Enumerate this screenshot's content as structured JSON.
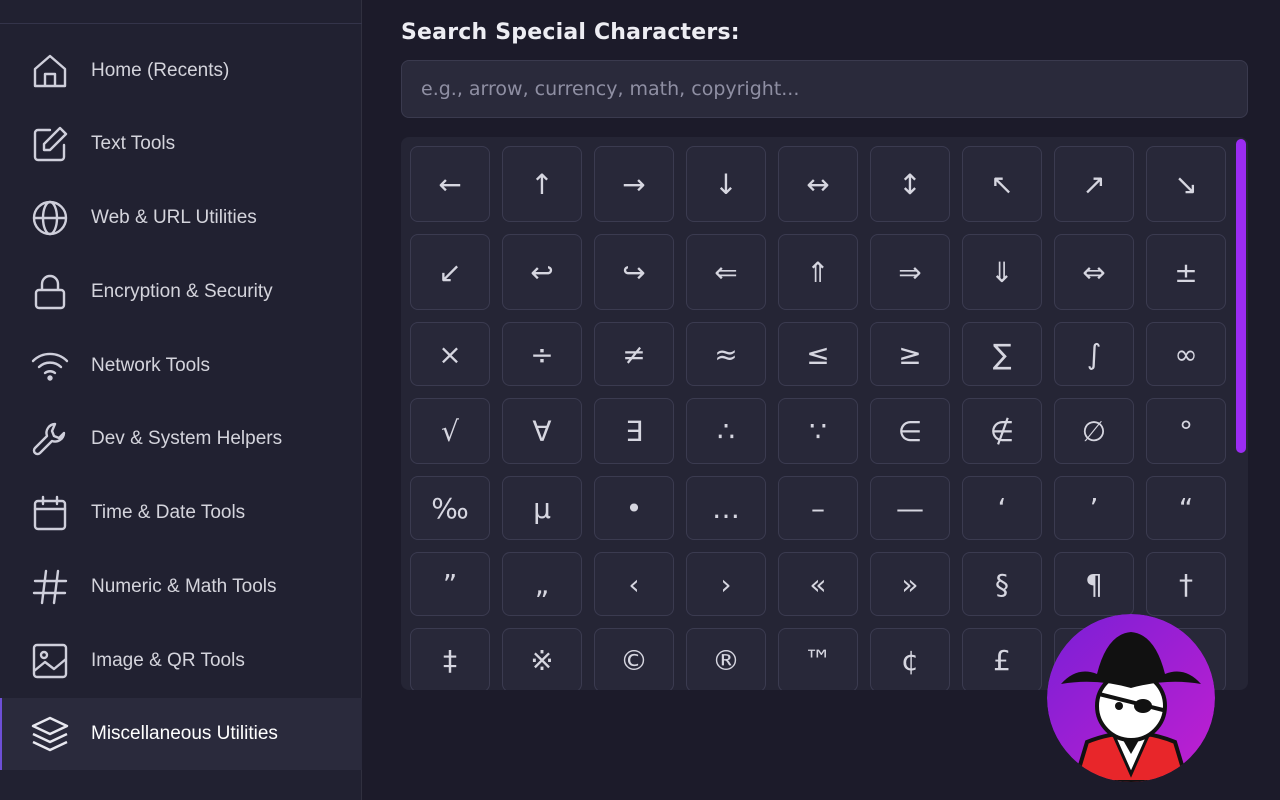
{
  "sidebar": {
    "items": [
      {
        "label": "Home (Recents)",
        "icon": "home-icon"
      },
      {
        "label": "Text Tools",
        "icon": "edit-icon"
      },
      {
        "label": "Web & URL Utilities",
        "icon": "globe-icon"
      },
      {
        "label": "Encryption & Security",
        "icon": "lock-icon"
      },
      {
        "label": "Network Tools",
        "icon": "wifi-icon"
      },
      {
        "label": "Dev & System Helpers",
        "icon": "wrench-icon"
      },
      {
        "label": "Time & Date Tools",
        "icon": "calendar-icon"
      },
      {
        "label": "Numeric & Math Tools",
        "icon": "hash-icon"
      },
      {
        "label": "Image & QR Tools",
        "icon": "image-icon"
      },
      {
        "label": "Miscellaneous Utilities",
        "icon": "layers-icon",
        "active": true
      }
    ]
  },
  "main": {
    "title": "Search Special Characters:",
    "search": {
      "placeholder": "e.g., arrow, currency, math, copyright...",
      "value": ""
    },
    "characters": [
      [
        "←",
        "↑",
        "→",
        "↓",
        "↔",
        "↕",
        "↖",
        "↗",
        "↘"
      ],
      [
        "↙",
        "↩",
        "↪",
        "⇐",
        "⇑",
        "⇒",
        "⇓",
        "⇔",
        "±"
      ],
      [
        "×",
        "÷",
        "≠",
        "≈",
        "≤",
        "≥",
        "∑",
        "∫",
        "∞"
      ],
      [
        "√",
        "∀",
        "∃",
        "∴",
        "∵",
        "∈",
        "∉",
        "∅",
        "°"
      ],
      [
        "‰",
        "μ",
        "•",
        "…",
        "–",
        "—",
        "‘",
        "’",
        "“"
      ],
      [
        "”",
        "„",
        "‹",
        "›",
        "«",
        "»",
        "§",
        "¶",
        "†"
      ],
      [
        "‡",
        "※",
        "©",
        "®",
        "™",
        "¢",
        "£",
        "",
        ""
      ]
    ]
  },
  "colors": {
    "background": "#1c1b2a",
    "sidebar": "#212131",
    "accent_scrollbar": "#9b2cf2",
    "avatar_bg": "#a21ed8"
  },
  "avatar": {
    "icon": "pirate-avatar-icon"
  }
}
